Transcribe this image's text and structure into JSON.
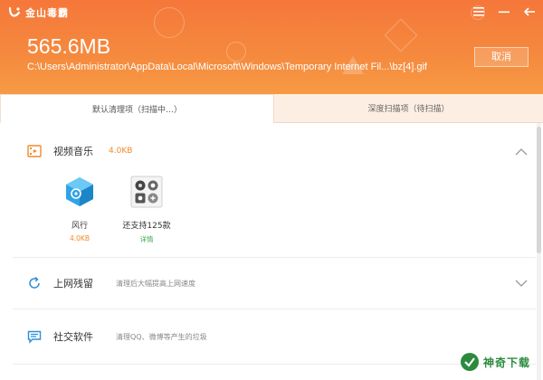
{
  "app": {
    "title": "金山毒霸",
    "window_controls": [
      "menu-icon",
      "minimize-icon",
      "back-icon"
    ]
  },
  "header": {
    "size": "565.6MB",
    "path": "C:\\Users\\Administrator\\AppData\\Local\\Microsoft\\Windows\\Temporary Internet Fil...\\bz[4].gif",
    "cancel_label": "取消"
  },
  "tabs": [
    {
      "label": "默认清理项（扫描中…）",
      "active": true
    },
    {
      "label": "深度扫描项（待扫描）",
      "active": false
    }
  ],
  "sections": [
    {
      "title": "视频音乐",
      "size": "4.0KB",
      "icon": "film-icon",
      "expanded": true,
      "items": [
        {
          "name": "风行",
          "meta": "4.0KB",
          "icon": "funshion-app-icon"
        },
        {
          "name": "还支持125款",
          "meta": "详情",
          "icon": "apps-grid-icon"
        }
      ]
    },
    {
      "title": "上网残留",
      "desc": "清理后大幅提高上网速度",
      "icon": "refresh-icon",
      "expanded": false
    },
    {
      "title": "社交软件",
      "desc": "清理QQ、微博等产生的垃圾",
      "icon": "chat-icon",
      "expanded": false
    }
  ],
  "watermark": {
    "text": "神奇下载"
  },
  "colors": {
    "header_start": "#f5773a",
    "header_end": "#f79a44",
    "accent_orange": "#f08a2a",
    "link_green": "#38a84a",
    "tab_inactive_bg": "#fdeee3"
  }
}
